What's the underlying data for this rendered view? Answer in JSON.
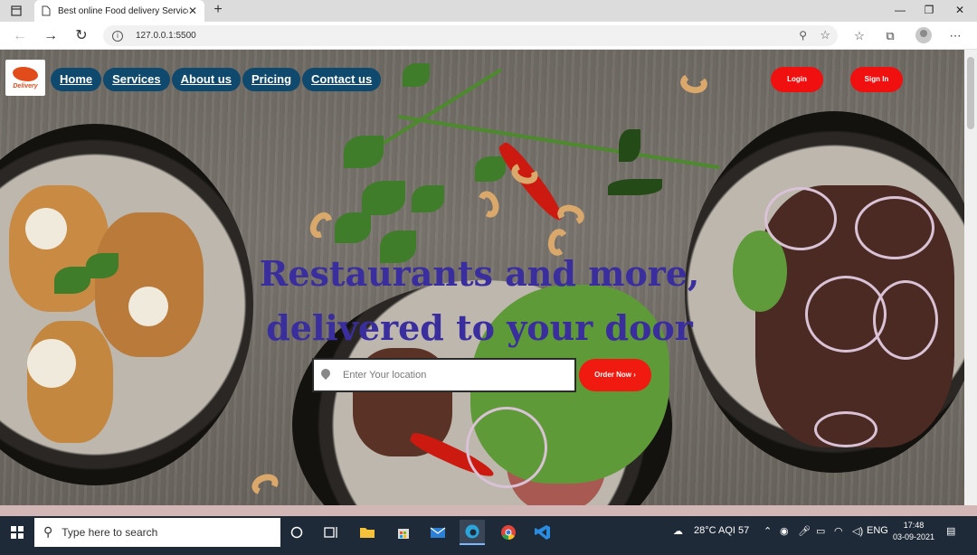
{
  "browser": {
    "tab_title": "Best online Food delivery Service",
    "tab_close": "✕",
    "new_tab": "+",
    "url": "127.0.0.1:5500",
    "window_controls": [
      "—",
      "❐",
      "✕"
    ]
  },
  "site": {
    "logo_text": "Delivery",
    "nav": [
      "Home",
      "Services",
      "About us",
      "Pricing",
      "Contact us"
    ],
    "login_label": "Login",
    "signin_label": "Sign In",
    "hero_line1": "Restaurants and more,",
    "hero_line2": "delivered to your door",
    "search_placeholder": "Enter Your location",
    "order_label": "Order Now",
    "order_arrow": "›"
  },
  "taskbar": {
    "search_placeholder": "Type here to search",
    "weather": "28°C AQI 57",
    "language": "ENG",
    "time": "17:48",
    "date": "03-09-2021"
  },
  "colors": {
    "nav_pill": "#0f4a6e",
    "cta_red": "#f01010",
    "hero_text": "#3a2e9e"
  }
}
